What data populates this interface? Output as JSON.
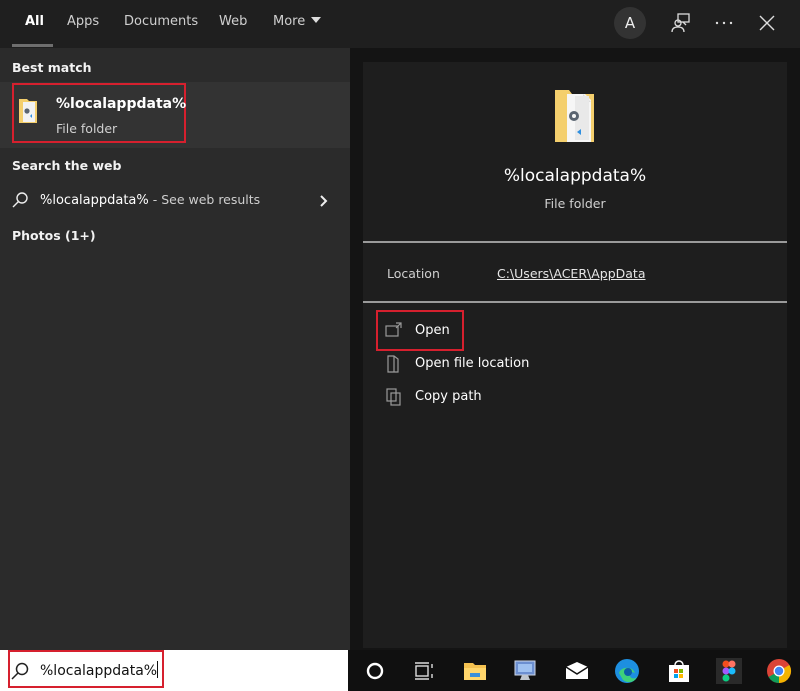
{
  "tabs": [
    {
      "label": "All",
      "active": true
    },
    {
      "label": "Apps"
    },
    {
      "label": "Documents"
    },
    {
      "label": "Web"
    },
    {
      "label": "More"
    }
  ],
  "topbar": {
    "avatar_initial": "A",
    "icons": [
      "feedback-icon",
      "more-options-icon",
      "close-icon"
    ]
  },
  "left": {
    "best_match_heading": "Best match",
    "best_match": {
      "title": "%localappdata%",
      "subtitle": "File folder",
      "icon": "folder-icon"
    },
    "search_web_heading": "Search the web",
    "web_result": {
      "query": "%localappdata%",
      "suffix": " - See web results"
    },
    "photos_heading": "Photos (1+)"
  },
  "preview": {
    "title": "%localappdata%",
    "subtitle": "File folder",
    "location_label": "Location",
    "location_value": "C:\\Users\\ACER\\AppData",
    "actions": [
      {
        "label": "Open",
        "icon": "open-icon"
      },
      {
        "label": "Open file location",
        "icon": "file-location-icon"
      },
      {
        "label": "Copy path",
        "icon": "copy-icon"
      }
    ]
  },
  "search": {
    "value": "%localappdata%"
  },
  "taskbar": {
    "icons": [
      "cortana-icon",
      "task-view-icon",
      "file-explorer-icon",
      "remote-desktop-icon",
      "mail-icon",
      "edge-icon",
      "store-icon",
      "figma-icon",
      "chrome-icon"
    ]
  },
  "colors": {
    "highlight": "#d6202e",
    "panel": "#2b2b2b",
    "preview": "#1e1e1e"
  }
}
